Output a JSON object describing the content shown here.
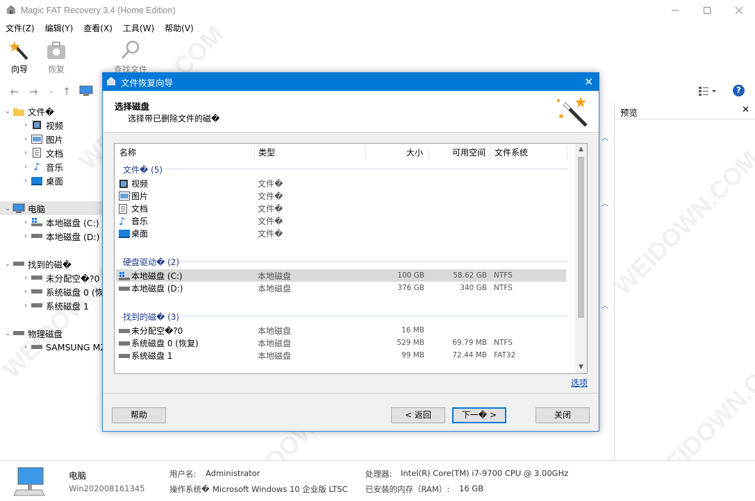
{
  "window": {
    "title": "Magic FAT Recovery 3.4 (Home Edition)"
  },
  "menu": [
    "文件(Z)",
    "编辑(Y)",
    "查看(X)",
    "工具(W)",
    "帮助(V)"
  ],
  "toolbar": {
    "wizard": "向导",
    "recover": "恢复",
    "find": "查找文件"
  },
  "tree": {
    "files_root": "文件�",
    "files_children": [
      "视频",
      "图片",
      "文档",
      "音乐",
      "桌面"
    ],
    "computer": "电脑",
    "computer_children": [
      "本地磁盘 (C:)",
      "本地磁盘 (D:)"
    ],
    "found": "找到的磁�",
    "found_children": [
      "未分配空�?0",
      "系统磁盘 0 (恢",
      "系统磁盘 1"
    ],
    "physical": "物理磁盘",
    "physical_children": [
      "SAMSUNG MZ"
    ]
  },
  "right_panel": {
    "title": "预览",
    "close": "✕"
  },
  "dialog": {
    "title": "文件恢复向导",
    "heading": "选择磁盘",
    "subheading": "选择带已删除文件的磁�",
    "columns": {
      "name": "名称",
      "type": "类型",
      "size": "大小",
      "free": "可用空间",
      "fs": "文件系统"
    },
    "groups": [
      {
        "label": "文件� (5)",
        "rows": [
          {
            "name": "视频",
            "type": "文件�",
            "size": "",
            "free": "",
            "fs": ""
          },
          {
            "name": "图片",
            "type": "文件�",
            "size": "",
            "free": "",
            "fs": ""
          },
          {
            "name": "文档",
            "type": "文件�",
            "size": "",
            "free": "",
            "fs": ""
          },
          {
            "name": "音乐",
            "type": "文件�",
            "size": "",
            "free": "",
            "fs": ""
          },
          {
            "name": "桌面",
            "type": "文件�",
            "size": "",
            "free": "",
            "fs": ""
          }
        ]
      },
      {
        "label": "硬盘驱动� (2)",
        "rows": [
          {
            "name": "本地磁盘 (C:)",
            "type": "本地磁盘",
            "size": "100 GB",
            "free": "58.62 GB",
            "fs": "NTFS"
          },
          {
            "name": "本地磁盘 (D:)",
            "type": "本地磁盘",
            "size": "376 GB",
            "free": "340 GB",
            "fs": "NTFS"
          }
        ]
      },
      {
        "label": "找到的磁� (3)",
        "rows": [
          {
            "name": "未分配空�?0",
            "type": "本地磁盘",
            "size": "16 MB",
            "free": "",
            "fs": ""
          },
          {
            "name": "系统磁盘 0 (恢复)",
            "type": "本地磁盘",
            "size": "529 MB",
            "free": "69.79 MB",
            "fs": "NTFS"
          },
          {
            "name": "系统磁盘 1",
            "type": "本地磁盘",
            "size": "99 MB",
            "free": "72.44 MB",
            "fs": "FAT32"
          }
        ]
      }
    ],
    "options_link": "选项",
    "buttons": {
      "help": "帮助",
      "back": "< 返回",
      "next": "下一� >",
      "close": "关闭"
    }
  },
  "status": {
    "name": "电脑",
    "machine": "Win202008161345",
    "user_label": "用户名:",
    "user_value": "Administrator",
    "os_label": "操作系统�",
    "os_value": "Microsoft Windows 10 企业版 LTSC",
    "cpu_label": "处理器:",
    "cpu_value": "Intel(R) Core(TM) i7-9700 CPU @ 3.00GHz",
    "ram_label": "已安装的内存（RAM）:",
    "ram_value": "16 GB"
  },
  "watermark": "WEIDOWN.COM",
  "colors": {
    "accent": "#0078d7",
    "link": "#0645ad",
    "selected_row": "#d9d9d9"
  }
}
